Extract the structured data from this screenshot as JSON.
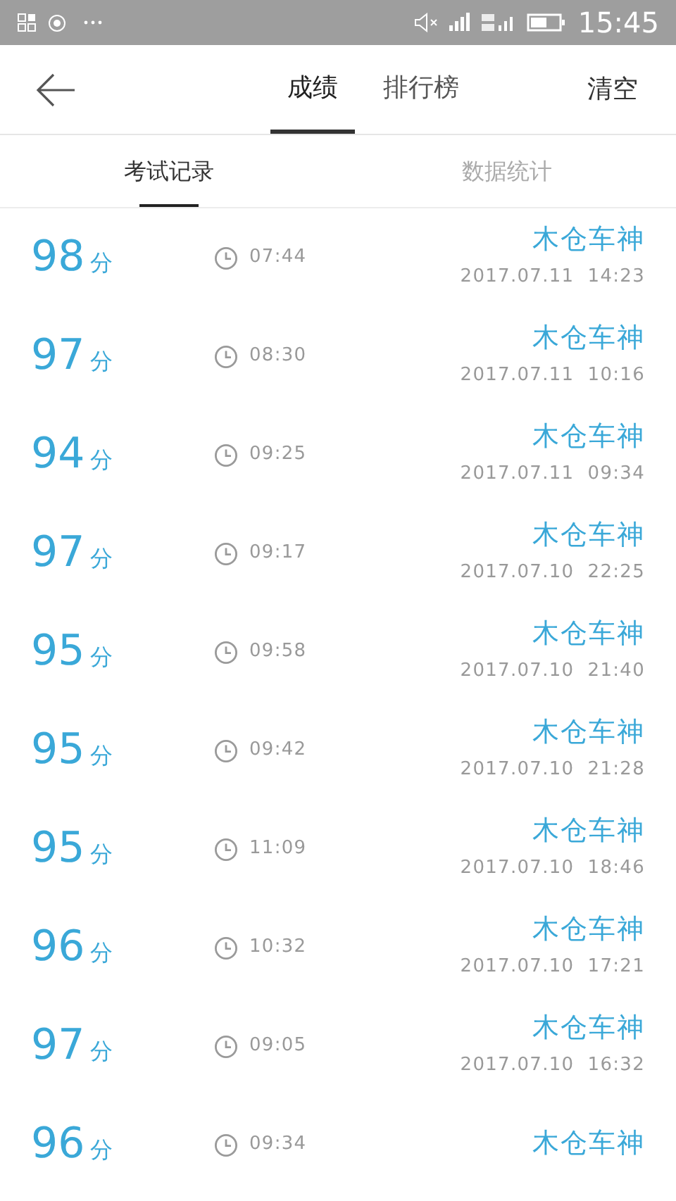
{
  "status_bar": {
    "time": "15:45"
  },
  "header": {
    "tabs": [
      {
        "label": "成绩",
        "selected": true
      },
      {
        "label": "排行榜",
        "selected": false
      }
    ],
    "action": "清空"
  },
  "sub_tabs": [
    {
      "label": "考试记录",
      "selected": true
    },
    {
      "label": "数据统计",
      "selected": false
    }
  ],
  "records": [
    {
      "score": "98",
      "unit": "分",
      "duration": "07:44",
      "name": "木仓车神",
      "date": "2017.07.11  14:23"
    },
    {
      "score": "97",
      "unit": "分",
      "duration": "08:30",
      "name": "木仓车神",
      "date": "2017.07.11  10:16"
    },
    {
      "score": "94",
      "unit": "分",
      "duration": "09:25",
      "name": "木仓车神",
      "date": "2017.07.11  09:34"
    },
    {
      "score": "97",
      "unit": "分",
      "duration": "09:17",
      "name": "木仓车神",
      "date": "2017.07.10  22:25"
    },
    {
      "score": "95",
      "unit": "分",
      "duration": "09:58",
      "name": "木仓车神",
      "date": "2017.07.10  21:40"
    },
    {
      "score": "95",
      "unit": "分",
      "duration": "09:42",
      "name": "木仓车神",
      "date": "2017.07.10  21:28"
    },
    {
      "score": "95",
      "unit": "分",
      "duration": "11:09",
      "name": "木仓车神",
      "date": "2017.07.10  18:46"
    },
    {
      "score": "96",
      "unit": "分",
      "duration": "10:32",
      "name": "木仓车神",
      "date": "2017.07.10  17:21"
    },
    {
      "score": "97",
      "unit": "分",
      "duration": "09:05",
      "name": "木仓车神",
      "date": "2017.07.10  16:32"
    },
    {
      "score": "96",
      "unit": "分",
      "duration": "09:34",
      "name": "木仓车神"
    }
  ]
}
